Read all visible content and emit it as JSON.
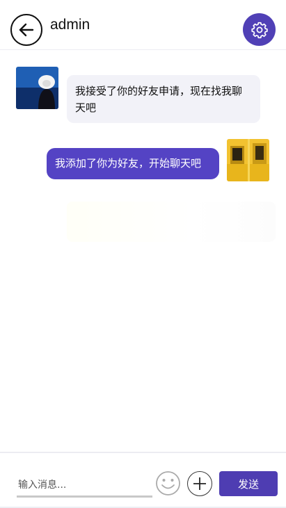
{
  "header": {
    "title": "admin",
    "back_icon": "arrow-left-icon",
    "settings_icon": "gear-icon",
    "accent_color": "#5040b6"
  },
  "messages": [
    {
      "side": "left",
      "text": "我接受了你的好友申请，现在找我聊天吧",
      "avatar": "person-with-hat-photo"
    },
    {
      "side": "right",
      "text": "我添加了你为好友，开始聊天吧",
      "avatar": "yellow-train-photo"
    }
  ],
  "composer": {
    "placeholder": "输入消息...",
    "emoji_icon": "smiley-icon",
    "plus_icon": "plus-icon",
    "send_label": "发送"
  }
}
